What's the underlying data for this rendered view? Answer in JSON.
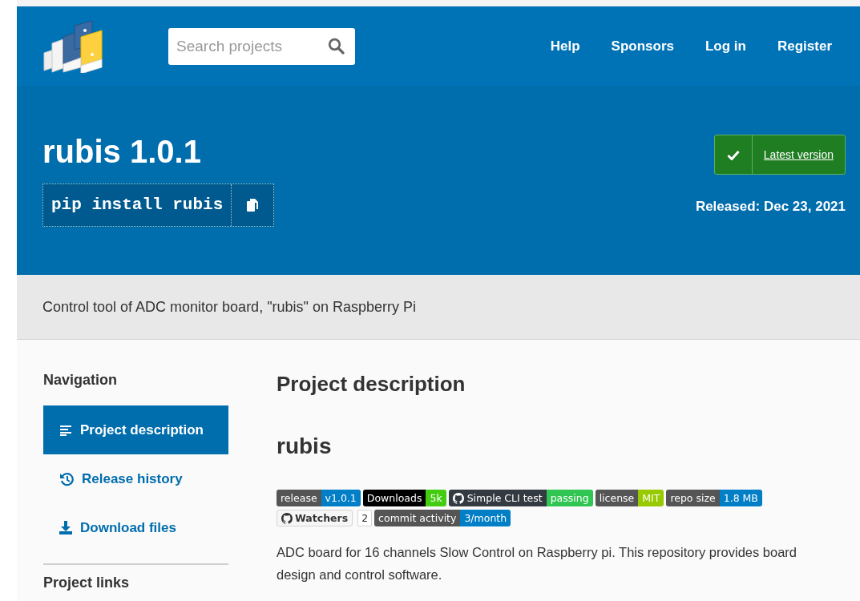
{
  "header": {
    "search": {
      "placeholder": "Search projects"
    },
    "nav": [
      "Help",
      "Sponsors",
      "Log in",
      "Register"
    ]
  },
  "hero": {
    "title": "rubis 1.0.1",
    "pip_command": "pip install rubis",
    "latest_label": "Latest version",
    "released": "Released: Dec 23, 2021"
  },
  "summary": "Control tool of ADC monitor board, \"rubis\" on Raspberry Pi",
  "sidebar": {
    "heading": "Navigation",
    "items": [
      {
        "label": "Project description",
        "selected": true
      },
      {
        "label": "Release history",
        "selected": false
      },
      {
        "label": "Download files",
        "selected": false
      }
    ],
    "next_heading": "Project links"
  },
  "main": {
    "heading": "Project description",
    "title": "rubis",
    "badges": [
      {
        "kind": "plain",
        "label": "release",
        "value": "v1.0.1",
        "color": "#007ec6"
      },
      {
        "kind": "inverse",
        "label": "Downloads",
        "value": "5k",
        "color": "#44cc11"
      },
      {
        "kind": "logo",
        "label": "Simple CLI test",
        "value": "passing",
        "color": "#31c653"
      },
      {
        "kind": "plain",
        "label": "license",
        "value": "MIT",
        "color": "#97ca00"
      },
      {
        "kind": "plain",
        "label": "repo size",
        "value": "1.8 MB",
        "color": "#007ec6"
      },
      {
        "kind": "social",
        "label": "Watchers",
        "value": "2"
      },
      {
        "kind": "plain",
        "label": "commit activity",
        "value": "3/month",
        "color": "#007ec6"
      }
    ],
    "paragraph": "ADC board for 16 channels Slow Control on Raspberry pi. This repository provides board design and control software."
  }
}
